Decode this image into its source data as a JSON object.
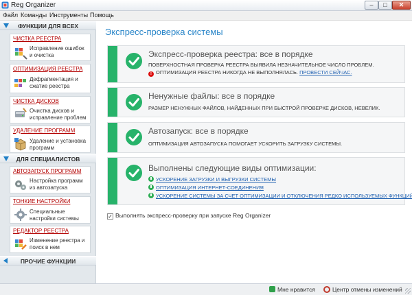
{
  "window": {
    "title": "Reg Organizer",
    "min_glyph": "–",
    "max_glyph": "□",
    "close_glyph": "✕"
  },
  "menu": [
    "Файл",
    "Команды",
    "Инструменты",
    "Помощь"
  ],
  "sidebar": {
    "section_all": "ФУНКЦИИ ДЛЯ ВСЕХ",
    "section_pro": "ДЛЯ СПЕЦИАЛИСТОВ",
    "section_other": "ПРОЧИЕ ФУНКЦИИ",
    "all_items": [
      {
        "title": "ЧИСТКА РЕЕСТРА",
        "desc1": "Исправление ошибок",
        "desc2": "и очистка",
        "icon": "registry-clean-icon"
      },
      {
        "title": "ОПТИМИЗАЦИЯ РЕЕСТРА",
        "desc1": "Дефрагментация и",
        "desc2": "сжатие реестра",
        "icon": "registry-optimize-icon"
      },
      {
        "title": "ЧИСТКА ДИСКОВ",
        "desc1": "Очистка дисков и",
        "desc2": "исправление проблем",
        "icon": "disk-clean-icon"
      },
      {
        "title": "УДАЛЕНИЕ ПРОГРАММ",
        "desc1": "Удаление и установка",
        "desc2": "программ",
        "icon": "uninstall-icon"
      }
    ],
    "pro_items": [
      {
        "title": "АВТОЗАПУСК ПРОГРАММ",
        "desc1": "Настройка программ",
        "desc2": "из автозапуска",
        "icon": "autorun-icon"
      },
      {
        "title": "ТОНКИЕ НАСТРОЙКИ",
        "desc1": "Специальные",
        "desc2": "настройки системы",
        "icon": "tweaks-icon"
      },
      {
        "title": "РЕДАКТОР РЕЕСТРА",
        "desc1": "Изменение реестра и",
        "desc2": "поиск в нем",
        "icon": "registry-editor-icon"
      }
    ]
  },
  "main": {
    "title": "Экспресс-проверка системы",
    "panels": [
      {
        "title": "Экспресс-проверка реестра: все в порядке",
        "line1": "ПОВЕРХНОСТНАЯ ПРОВЕРКА РЕЕСТРА ВЫЯВИЛА НЕЗНАЧИТЕЛЬНОЕ ЧИСЛО ПРОБЛЕМ.",
        "warn_text": "ОПТИМИЗАЦИЯ РЕЕСТРА НИКОГДА НЕ ВЫПОЛНЯЛАСЬ.",
        "warn_link": "ПРОВЕСТИ СЕЙЧАС."
      },
      {
        "title": "Ненужные файлы: все в порядке",
        "line1": "РАЗМЕР НЕНУЖНЫХ ФАЙЛОВ, НАЙДЕННЫХ ПРИ БЫСТРОЙ ПРОВЕРКЕ ДИСКОВ, НЕВЕЛИК."
      },
      {
        "title": "Автозапуск: все в порядке",
        "line1": "ОПТИМИЗАЦИЯ АВТОЗАПУСКА ПОМОГАЕТ УСКОРИТЬ ЗАГРУЗКУ СИСТЕМЫ."
      },
      {
        "title": "Выполнены следующие виды оптимизации:",
        "items": [
          "УСКОРЕНИЕ ЗАГРУЗКИ И ВЫГРУЗКИ СИСТЕМЫ",
          "ОПТИМИЗАЦИЯ ИНТЕРНЕТ-СОЕДИНЕНИЯ",
          "УСКОРЕНИЕ СИСТЕМЫ ЗА СЧЕТ ОПТИМИЗАЦИИ И ОТКЛЮЧЕНИЯ РЕДКО ИСПОЛЬЗУЕМЫХ ФУНКЦИЙ"
        ]
      }
    ],
    "checkbox_label": "Выполнять экспресс-проверку при запуске Reg Organizer",
    "checkbox_checked": true
  },
  "status": {
    "like": "Мне нравится",
    "undo_center": "Центр отмены изменений"
  },
  "colors": {
    "accent": "#2a86c9",
    "ok_green": "#27b36a",
    "link": "#1d5fb0",
    "sidebar_title": "#b30000"
  }
}
